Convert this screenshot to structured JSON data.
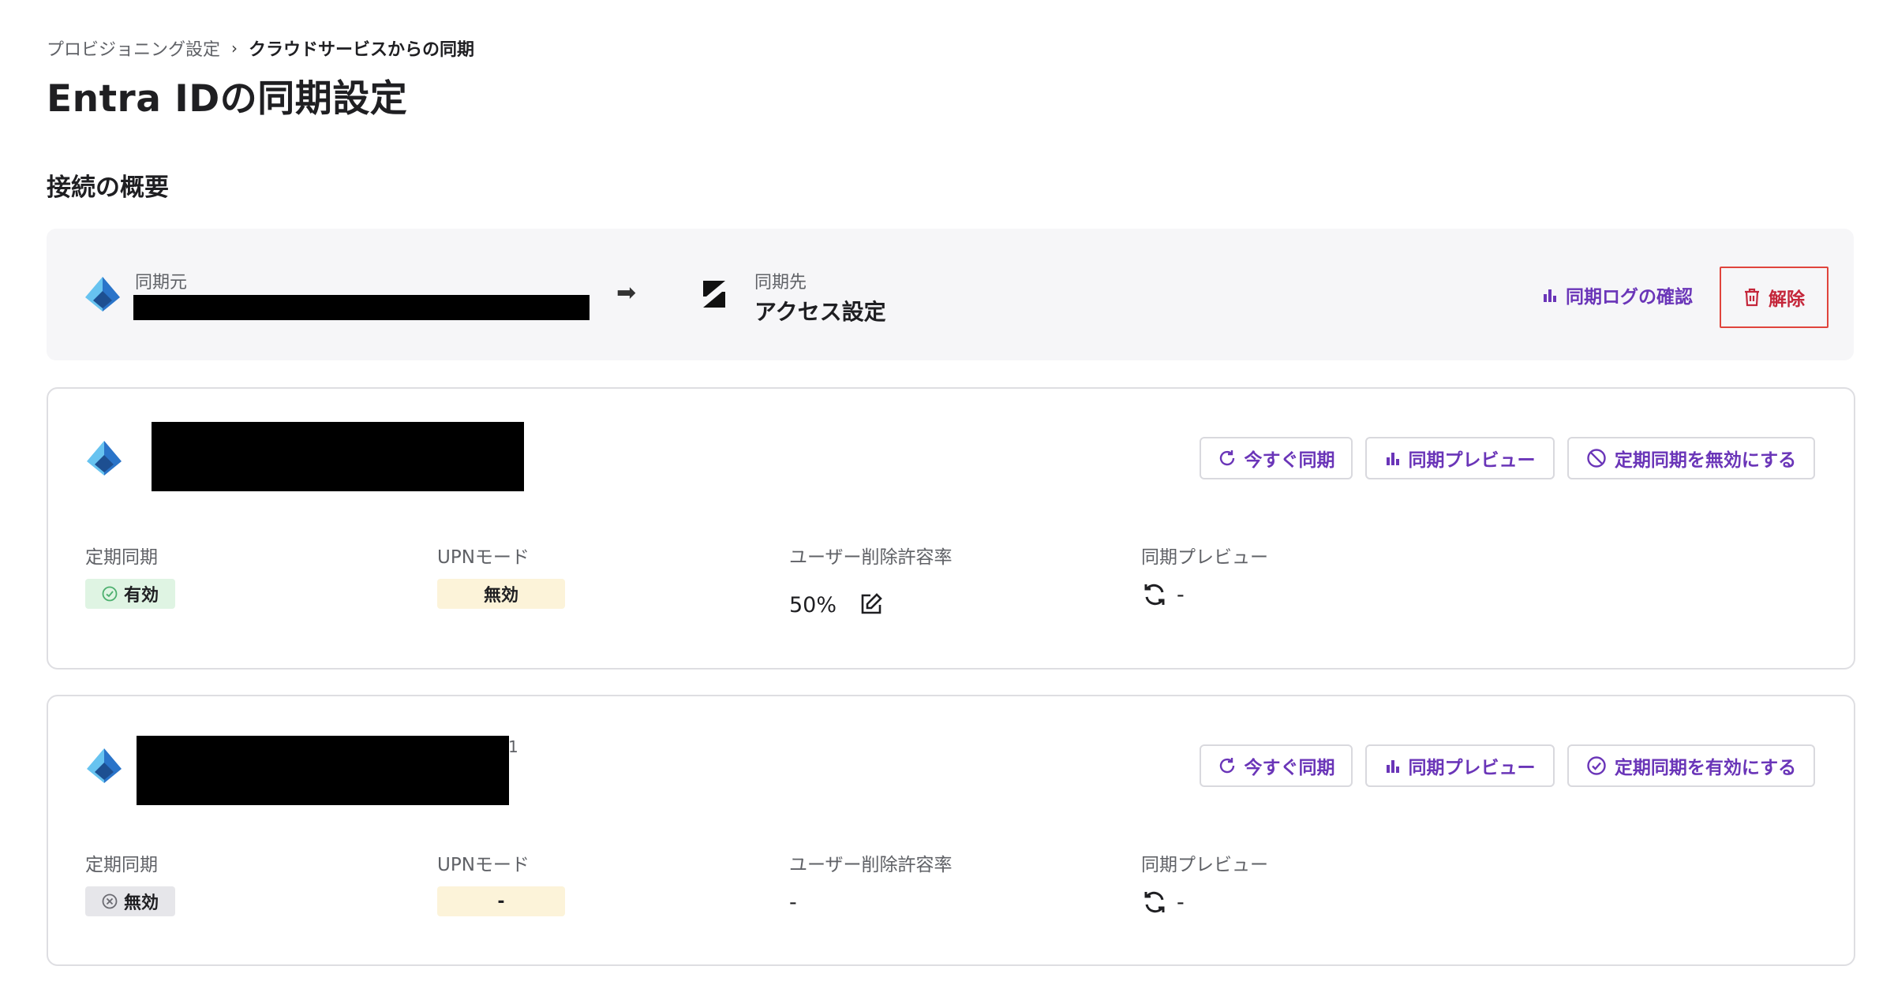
{
  "breadcrumb": {
    "parent": "プロビジョニング設定",
    "separator": "›",
    "current": "クラウドサービスからの同期"
  },
  "page_title": "Entra IDの同期設定",
  "overview": {
    "section_title": "接続の概要",
    "source_label": "同期元",
    "dest_label": "同期先",
    "dest_name": "アクセス設定",
    "arrow": "➡",
    "sync_log_button": "同期ログの確認",
    "disconnect_button": "解除"
  },
  "cards": [
    {
      "sync_now_button": "今すぐ同期",
      "preview_button": "同期プレビュー",
      "toggle_button": "定期同期を無効にする",
      "fields": {
        "periodic_label": "定期同期",
        "periodic_value": "有効",
        "upn_label": "UPNモード",
        "upn_value": "無効",
        "delete_rate_label": "ユーザー削除許容率",
        "delete_rate_value": "50%",
        "preview_label": "同期プレビュー",
        "preview_value": "-"
      }
    },
    {
      "name_suffix": "1",
      "sync_now_button": "今すぐ同期",
      "preview_button": "同期プレビュー",
      "toggle_button": "定期同期を有効にする",
      "fields": {
        "periodic_label": "定期同期",
        "periodic_value": "無効",
        "upn_label": "UPNモード",
        "upn_value": "-",
        "delete_rate_label": "ユーザー削除許容率",
        "delete_rate_value": "-",
        "preview_label": "同期プレビュー",
        "preview_value": "-"
      }
    }
  ],
  "colors": {
    "accent": "#6a35b8",
    "danger": "#c4263a",
    "success_bg": "#dff4e3",
    "neutral_bg": "#e6e6ea",
    "warning_bg": "#fcf3d9"
  }
}
